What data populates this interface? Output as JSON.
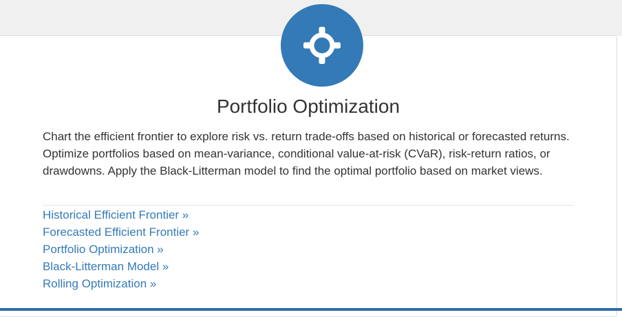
{
  "card": {
    "icon": "crosshair-icon",
    "title": "Portfolio Optimization",
    "description": "Chart the efficient frontier to explore risk vs. return trade-offs based on historical or forecasted returns. Optimize portfolios based on mean-variance, conditional value-at-risk (CVaR), risk-return ratios, or drawdowns. Apply the Black-Litterman model to find the optimal portfolio based on market views.",
    "links": [
      "Historical Efficient Frontier »",
      "Forecasted Efficient Frontier »",
      "Portfolio Optimization »",
      "Black-Litterman Model »",
      "Rolling Optimization »"
    ]
  },
  "colors": {
    "accent": "#337ab7",
    "text": "#333333",
    "divider": "#e5e5e5",
    "bottom_bar": "#2e6da4"
  }
}
